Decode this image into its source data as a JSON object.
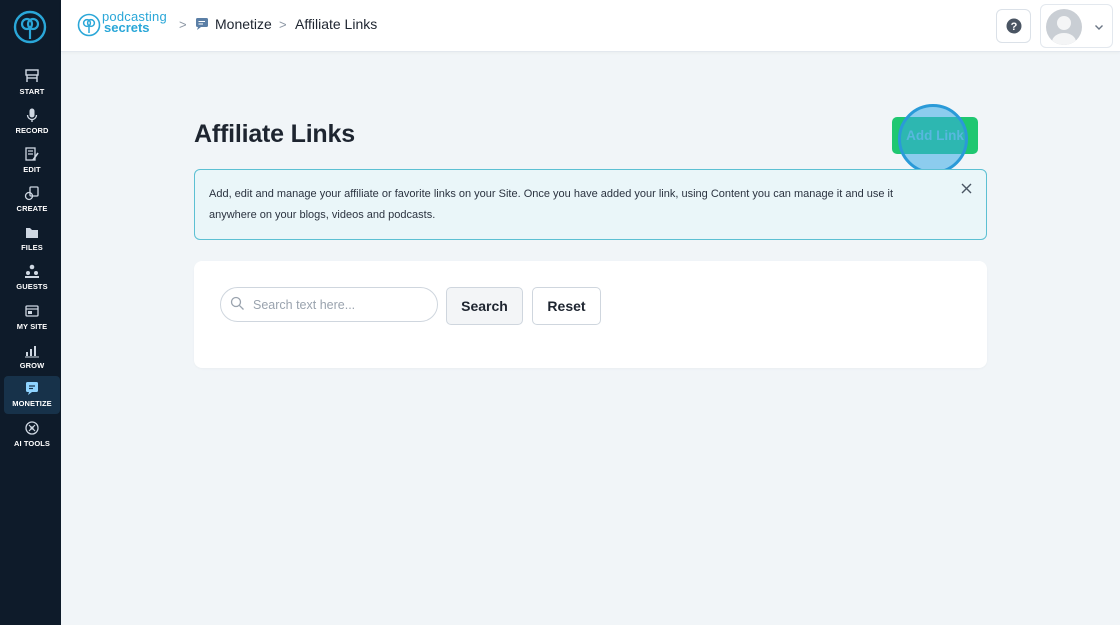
{
  "sidebar": {
    "items": [
      {
        "label": "START",
        "icon": "start-icon"
      },
      {
        "label": "RECORD",
        "icon": "microphone-icon"
      },
      {
        "label": "EDIT",
        "icon": "edit-icon"
      },
      {
        "label": "CREATE",
        "icon": "create-icon"
      },
      {
        "label": "FILES",
        "icon": "folder-icon"
      },
      {
        "label": "GUESTS",
        "icon": "guests-icon"
      },
      {
        "label": "MY SITE",
        "icon": "site-icon"
      },
      {
        "label": "GROW",
        "icon": "chart-icon"
      },
      {
        "label": "MONETIZE",
        "icon": "monetize-icon",
        "active": true
      },
      {
        "label": "AI TOOLS",
        "icon": "ai-tools-icon"
      }
    ]
  },
  "header": {
    "brand_line1": "podcasting",
    "brand_line2": "secrets",
    "breadcrumb": {
      "section": "Monetize",
      "current": "Affiliate Links",
      "separator": ">"
    }
  },
  "main": {
    "title": "Affiliate Links",
    "add_button": "Add Link",
    "info_text": "Add, edit and manage your affiliate or favorite links on your Site. Once you have added your link, using Content you can manage it and use it anywhere on your blogs, videos and podcasts.",
    "search": {
      "placeholder": "Search text here...",
      "value": "",
      "search_label": "Search",
      "reset_label": "Reset"
    }
  },
  "colors": {
    "sidebar_bg": "#0e1b2a",
    "accent_green": "#1fc771",
    "brand_blue": "#2aa7d8",
    "info_border": "#5cc0d3",
    "page_bg": "#f1f5f8"
  }
}
